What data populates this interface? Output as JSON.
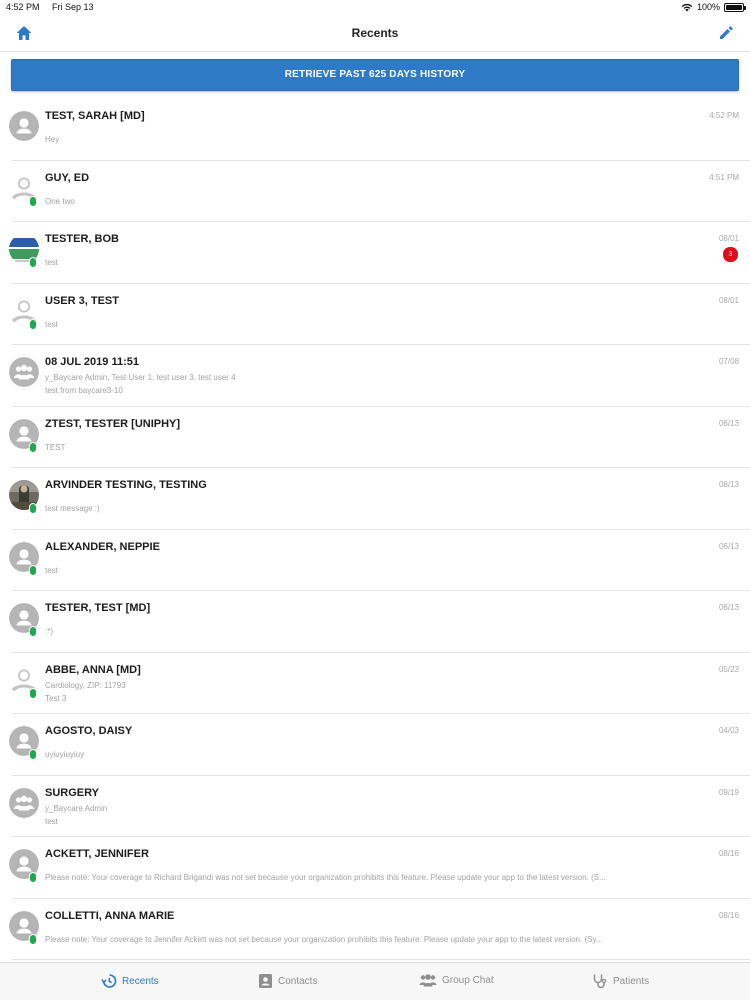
{
  "status_bar": {
    "time": "4:52 PM",
    "date": "Fri Sep 13",
    "battery": "100%",
    "wifi_icon": "wifi-icon"
  },
  "header": {
    "title": "Recents",
    "left_icon": "home-icon",
    "right_icon": "pencil-icon"
  },
  "retrieve_button": {
    "label": "RETRIEVE PAST 625 DAYS HISTORY"
  },
  "colors": {
    "accent": "#2f7ac6",
    "online": "#1fa84a",
    "badge": "#e30b17"
  },
  "conversations": [
    {
      "name": "TEST, SARAH [MD]",
      "time": "4:52 PM",
      "line1": "",
      "line2": "Hey",
      "avatar": "person",
      "online": false,
      "badge": ""
    },
    {
      "name": "GUY, ED",
      "time": "4:51 PM",
      "line1": "",
      "line2": "One two",
      "avatar": "person-outline",
      "online": true,
      "badge": ""
    },
    {
      "name": "TESTER, BOB",
      "time": "08/01",
      "line1": "",
      "line2": "test",
      "avatar": "logo",
      "online": true,
      "badge": "3"
    },
    {
      "name": "USER 3, TEST",
      "time": "08/01",
      "line1": "",
      "line2": "test",
      "avatar": "person-outline",
      "online": true,
      "badge": ""
    },
    {
      "name": "08 JUL 2019 11:51",
      "time": "07/08",
      "line1": "y_Baycare Admin, Test User 1, test user 3, test user 4",
      "line2": "test from baycare3-10",
      "avatar": "group",
      "online": false,
      "badge": ""
    },
    {
      "name": "ZTEST, TESTER [UNIPHY]",
      "time": "06/13",
      "line1": "",
      "line2": "TEST",
      "avatar": "person",
      "online": true,
      "badge": ""
    },
    {
      "name": "ARVINDER TESTING, TESTING",
      "time": "06/13",
      "line1": "",
      "line2": "test message :)",
      "avatar": "photo",
      "online": true,
      "badge": ""
    },
    {
      "name": "ALEXANDER, NEPPIE",
      "time": "06/13",
      "line1": "",
      "line2": "test",
      "avatar": "person",
      "online": true,
      "badge": ""
    },
    {
      "name": "TESTER, TEST [MD]",
      "time": "06/13",
      "line1": "",
      "line2": ":*)",
      "avatar": "person",
      "online": true,
      "badge": ""
    },
    {
      "name": "ABBE, ANNA [MD]",
      "time": "05/23",
      "line1": "Cardiology, ZIP: 11793",
      "line2": "Test 3",
      "avatar": "person-outline",
      "online": true,
      "badge": ""
    },
    {
      "name": "AGOSTO, DAISY",
      "time": "04/03",
      "line1": "",
      "line2": "uyiuyiuyiuy",
      "avatar": "person",
      "online": true,
      "badge": ""
    },
    {
      "name": "SURGERY",
      "time": "09/19",
      "line1": "y_Baycare Admin",
      "line2": "test",
      "avatar": "group",
      "online": false,
      "badge": ""
    },
    {
      "name": "ACKETT, JENNIFER",
      "time": "08/16",
      "line1": "",
      "line2": "Please note: Your coverage to Richard Brigandi  was not set because your organization prohibits this feature. Please update your app to the latest version. (S...",
      "avatar": "person",
      "online": true,
      "badge": ""
    },
    {
      "name": "COLLETTI, ANNA MARIE",
      "time": "08/16",
      "line1": "",
      "line2": "Please note: Your coverage to Jennifer Ackett  was not set because your organization prohibits this feature. Please update your app to the latest version. (Sy...",
      "avatar": "person",
      "online": true,
      "badge": ""
    }
  ],
  "tabs": [
    {
      "label": "Recents",
      "icon": "clock-history-icon",
      "active": true
    },
    {
      "label": "Contacts",
      "icon": "contact-card-icon",
      "active": false
    },
    {
      "label": "Group Chat",
      "icon": "group-icon",
      "active": false
    },
    {
      "label": "Patients",
      "icon": "stethoscope-icon",
      "active": false
    }
  ]
}
